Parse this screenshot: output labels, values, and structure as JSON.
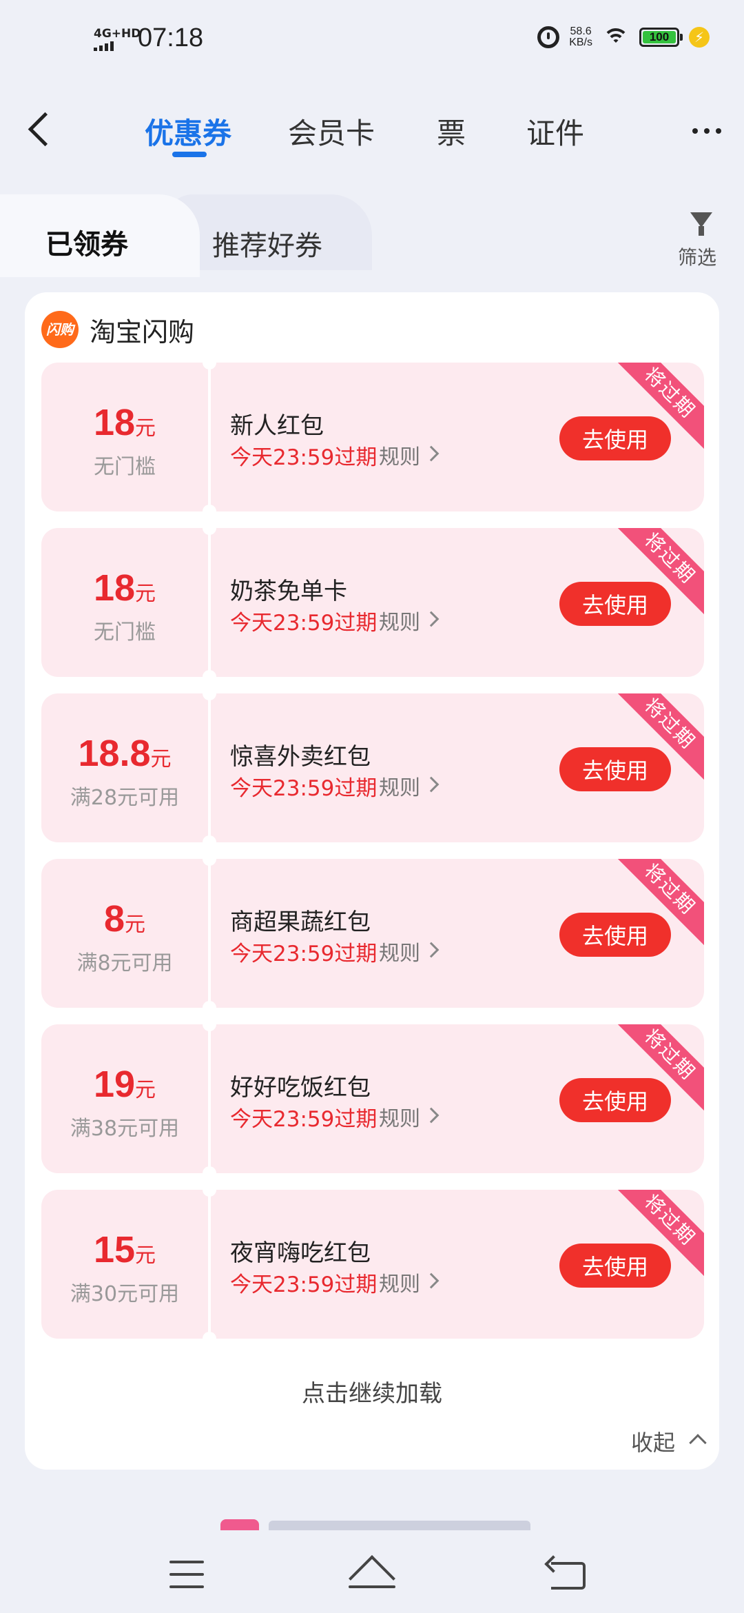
{
  "status_bar": {
    "network": "4G+HD",
    "time": "07:18",
    "speed_value": "58.6",
    "speed_unit": "KB/s",
    "battery": "100"
  },
  "top_tabs": [
    {
      "label": "优惠券",
      "active": true
    },
    {
      "label": "会员卡",
      "active": false
    },
    {
      "label": "票",
      "active": false
    },
    {
      "label": "证件",
      "active": false
    }
  ],
  "sub_tabs": {
    "active": "已领券",
    "second": "推荐好券",
    "filter_label": "筛选"
  },
  "shop": {
    "logo_text": "闪购",
    "name": "淘宝闪购"
  },
  "coupons": [
    {
      "amount": "18",
      "unit": "元",
      "condition": "无门槛",
      "title": "新人红包",
      "expire": "今天23:59过期",
      "rule": "规则",
      "button": "去使用",
      "ribbon": "将过期"
    },
    {
      "amount": "18",
      "unit": "元",
      "condition": "无门槛",
      "title": "奶茶免单卡",
      "expire": "今天23:59过期",
      "rule": "规则",
      "button": "去使用",
      "ribbon": "将过期"
    },
    {
      "amount": "18.8",
      "unit": "元",
      "condition": "满28元可用",
      "title": "惊喜外卖红包",
      "expire": "今天23:59过期",
      "rule": "规则",
      "button": "去使用",
      "ribbon": "将过期"
    },
    {
      "amount": "8",
      "unit": "元",
      "condition": "满8元可用",
      "title": "商超果蔬红包",
      "expire": "今天23:59过期",
      "rule": "规则",
      "button": "去使用",
      "ribbon": "将过期"
    },
    {
      "amount": "19",
      "unit": "元",
      "condition": "满38元可用",
      "title": "好好吃饭红包",
      "expire": "今天23:59过期",
      "rule": "规则",
      "button": "去使用",
      "ribbon": "将过期"
    },
    {
      "amount": "15",
      "unit": "元",
      "condition": "满30元可用",
      "title": "夜宵嗨吃红包",
      "expire": "今天23:59过期",
      "rule": "规则",
      "button": "去使用",
      "ribbon": "将过期"
    }
  ],
  "footer": {
    "load_more": "点击继续加载",
    "collapse": "收起"
  },
  "colors": {
    "accent_blue": "#1a73e8",
    "coupon_red": "#e8292f",
    "coupon_bg": "#fdeaef",
    "ribbon_pink": "#f2517a"
  }
}
